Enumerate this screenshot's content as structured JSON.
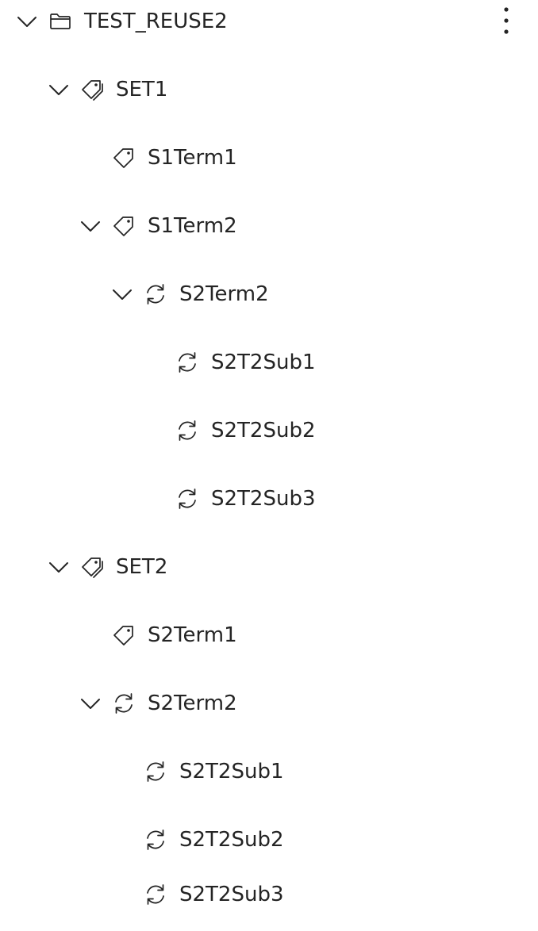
{
  "tree": {
    "root": {
      "label": "TEST_REUSE2",
      "icon": "folder-icon",
      "expanded": true,
      "more_icon": "more-vertical-icon"
    },
    "items": [
      {
        "label": "SET1",
        "icon": "tags-icon",
        "expanded": true
      },
      {
        "label": "S1Term1",
        "icon": "tag-icon"
      },
      {
        "label": "S1Term2",
        "icon": "tag-icon",
        "expanded": true
      },
      {
        "label": "S2Term2",
        "icon": "sync-icon",
        "expanded": true
      },
      {
        "label": "S2T2Sub1",
        "icon": "sync-icon"
      },
      {
        "label": "S2T2Sub2",
        "icon": "sync-icon"
      },
      {
        "label": "S2T2Sub3",
        "icon": "sync-icon"
      },
      {
        "label": "SET2",
        "icon": "tags-icon",
        "expanded": true
      },
      {
        "label": "S2Term1",
        "icon": "tag-icon"
      },
      {
        "label": "S2Term2",
        "icon": "sync-icon",
        "expanded": true
      },
      {
        "label": "S2T2Sub1",
        "icon": "sync-icon"
      },
      {
        "label": "S2T2Sub2",
        "icon": "sync-icon"
      },
      {
        "label": "S2T2Sub3",
        "icon": "sync-icon"
      }
    ]
  }
}
